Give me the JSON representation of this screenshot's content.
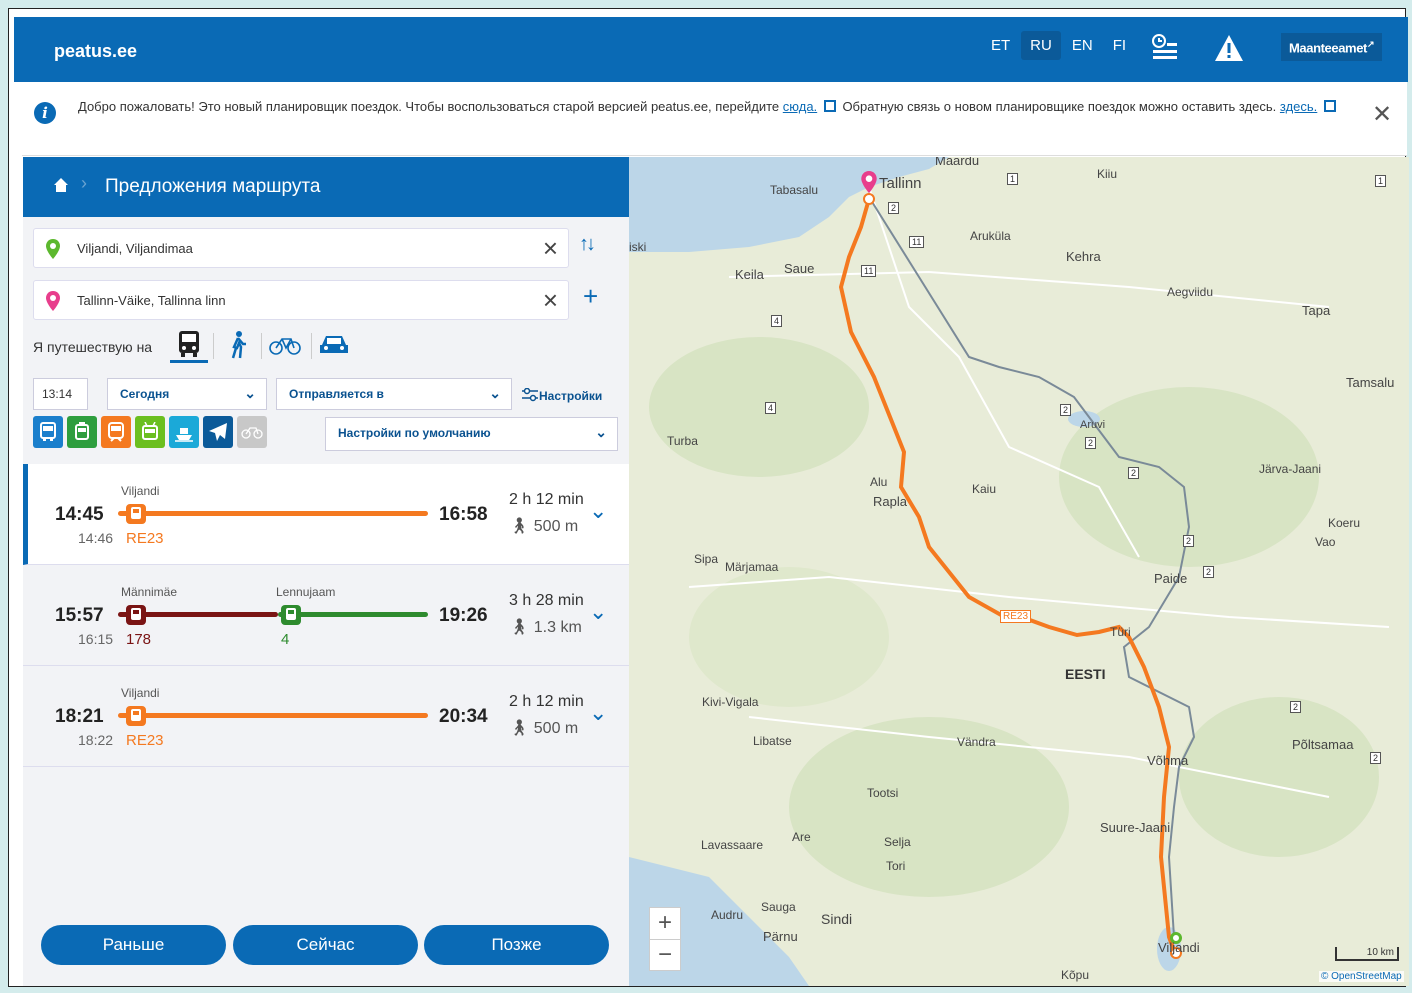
{
  "header": {
    "logo": "peatus.ee",
    "languages": [
      {
        "code": "ET",
        "active": false
      },
      {
        "code": "RU",
        "active": true
      },
      {
        "code": "EN",
        "active": false
      },
      {
        "code": "FI",
        "active": false
      }
    ],
    "maanteeamet": "Maanteeamet",
    "icons": [
      "timetable-icon",
      "warning-icon",
      "external-link-icon"
    ]
  },
  "notice": {
    "text_1": "Добро пожаловать! Это новый планировщик поездок. Чтобы воспользоваться старой версией peatus.ee, перейдите",
    "link_1": "сюда.",
    "text_2": "Обратную связь о новом планировщике поездок можно оставить здесь.",
    "link_2": "здесь."
  },
  "panel": {
    "title": "Предложения маршрута",
    "origin": "Viljandi, Viljandimaa",
    "destination": "Tallinn-Väike, Tallinna linn",
    "modes_label": "Я путешествую на",
    "time": "13:14",
    "day": "Сегодня",
    "departure_mode": "Отправляется в",
    "settings": "Настройки",
    "preset": "Настройки по умолчанию"
  },
  "routes": [
    {
      "depart": "14:45",
      "orig_time": "14:46",
      "arrive": "16:58",
      "duration": "2 h 12 min",
      "walk": "500 m",
      "legs": [
        {
          "stop": "Viljandi",
          "line": "RE23",
          "color": "#f47920"
        }
      ]
    },
    {
      "depart": "15:57",
      "orig_time": "16:15",
      "arrive": "19:26",
      "duration": "3 h 28 min",
      "walk": "1.3 km",
      "legs": [
        {
          "stop": "Männimäe",
          "line": "178",
          "color": "#7a1414"
        },
        {
          "stop": "Lennujaam",
          "line": "4",
          "color": "#2e8b2e"
        }
      ]
    },
    {
      "depart": "18:21",
      "orig_time": "18:22",
      "arrive": "20:34",
      "duration": "2 h 12 min",
      "walk": "500 m",
      "legs": [
        {
          "stop": "Viljandi",
          "line": "RE23",
          "color": "#f47920"
        }
      ]
    }
  ],
  "buttons": {
    "earlier": "Раньше",
    "now": "Сейчас",
    "later": "Позже"
  },
  "map": {
    "places": [
      "Maardu",
      "Tabasalu",
      "Tallinn",
      "Kiiu",
      "Aruküla",
      "Kehra",
      "Keila",
      "Saue",
      "Aegviidu",
      "Tapa",
      "Tamsalu",
      "Turba",
      "Aruvi",
      "Järva-Jaani",
      "Alu",
      "Rapla",
      "Kaiu",
      "Koeru",
      "Vao",
      "Sipa",
      "Märjamaa",
      "Paide",
      "EESTI",
      "Türi",
      "Kivi-Vigala",
      "Libatse",
      "Vändra",
      "Võhma",
      "Põltsamaa",
      "Tootsi",
      "Suure-Jaani",
      "Lavassaare",
      "Are",
      "Selja",
      "Tori",
      "Audru",
      "Sauga",
      "Sindi",
      "Pärnu",
      "Viljandi",
      "Kõpu",
      "iski"
    ],
    "route_label": "RE23",
    "scale": "10 km",
    "attribution": "© OpenStreetMap"
  }
}
